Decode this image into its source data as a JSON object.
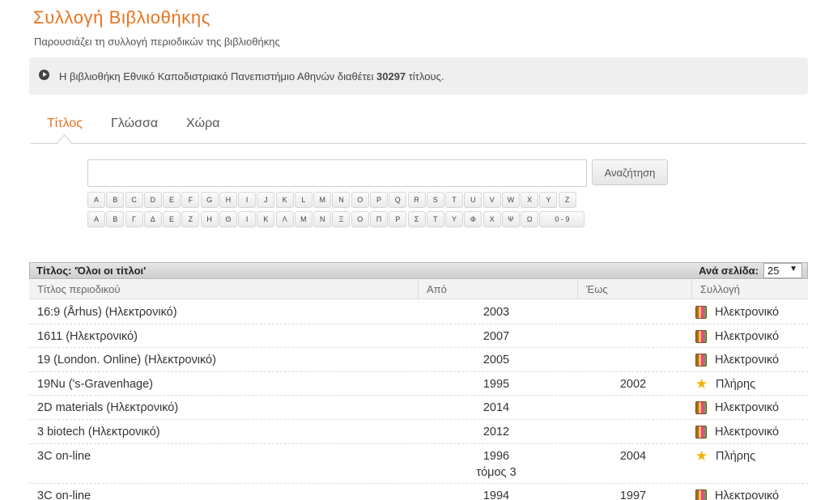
{
  "header": {
    "title": "Συλλογή Βιβλιοθήκης",
    "subtitle": "Παρουσιάζει τη συλλογή περιοδικών της βιβλιοθήκης"
  },
  "info": {
    "prefix": "Η βιβλιοθήκη Εθνικό Καποδιστριακό Πανεπιστήμιο Αθηνών διαθέτει",
    "count": "30297",
    "suffix": "τίτλους."
  },
  "tabs": [
    {
      "label": "Τίτλος",
      "active": true
    },
    {
      "label": "Γλώσσα",
      "active": false
    },
    {
      "label": "Χώρα",
      "active": false
    }
  ],
  "search": {
    "placeholder": "",
    "value": "",
    "button_label": "Αναζήτηση"
  },
  "alphabet": {
    "latin": [
      "A",
      "B",
      "C",
      "D",
      "E",
      "F",
      "G",
      "H",
      "I",
      "J",
      "K",
      "L",
      "M",
      "N",
      "O",
      "P",
      "Q",
      "R",
      "S",
      "T",
      "U",
      "V",
      "W",
      "X",
      "Y",
      "Z"
    ],
    "greek": [
      "Α",
      "Β",
      "Γ",
      "Δ",
      "Ε",
      "Ζ",
      "Η",
      "Θ",
      "Ι",
      "Κ",
      "Λ",
      "Μ",
      "Ν",
      "Ξ",
      "Ο",
      "Π",
      "Ρ",
      "Σ",
      "Τ",
      "Υ",
      "Φ",
      "Χ",
      "Ψ",
      "Ω"
    ],
    "digits": "0 - 9"
  },
  "table": {
    "caption": "Τίτλος: 'Όλοι οι τίτλοι'",
    "per_page_label": "Ανά σελίδα:",
    "per_page_value": "25",
    "columns": [
      "Τίτλος περιοδικού",
      "Από",
      "Έως",
      "Συλλογή"
    ],
    "rows": [
      {
        "title": "16:9 (Århus) (Ηλεκτρονικό)",
        "from": "2003",
        "from_note": "",
        "to": "",
        "collection": "Ηλεκτρονικό",
        "icon": "book-icon"
      },
      {
        "title": "1611 (Ηλεκτρονικό)",
        "from": "2007",
        "from_note": "",
        "to": "",
        "collection": "Ηλεκτρονικό",
        "icon": "book-icon"
      },
      {
        "title": "19 (London. Online) (Ηλεκτρονικό)",
        "from": "2005",
        "from_note": "",
        "to": "",
        "collection": "Ηλεκτρονικό",
        "icon": "book-icon"
      },
      {
        "title": "19Nu ('s-Gravenhage)",
        "from": "1995",
        "from_note": "",
        "to": "2002",
        "collection": "Πλήρης",
        "icon": "star-icon"
      },
      {
        "title": "2D materials (Ηλεκτρονικό)",
        "from": "2014",
        "from_note": "",
        "to": "",
        "collection": "Ηλεκτρονικό",
        "icon": "book-icon"
      },
      {
        "title": "3 biotech (Ηλεκτρονικό)",
        "from": "2012",
        "from_note": "",
        "to": "",
        "collection": "Ηλεκτρονικό",
        "icon": "book-icon"
      },
      {
        "title": "3C on-line",
        "from": "1996",
        "from_note": "τόμος 3",
        "to": "2004",
        "collection": "Πλήρης",
        "icon": "star-icon"
      },
      {
        "title": "3C on-line",
        "from": "1994",
        "from_note": "",
        "to": "1997",
        "collection": "Ηλεκτρονικό",
        "icon": "book-icon"
      }
    ]
  },
  "colors": {
    "accent": "#e8741e",
    "info_bg": "#efefef",
    "star": "#f0b400"
  }
}
